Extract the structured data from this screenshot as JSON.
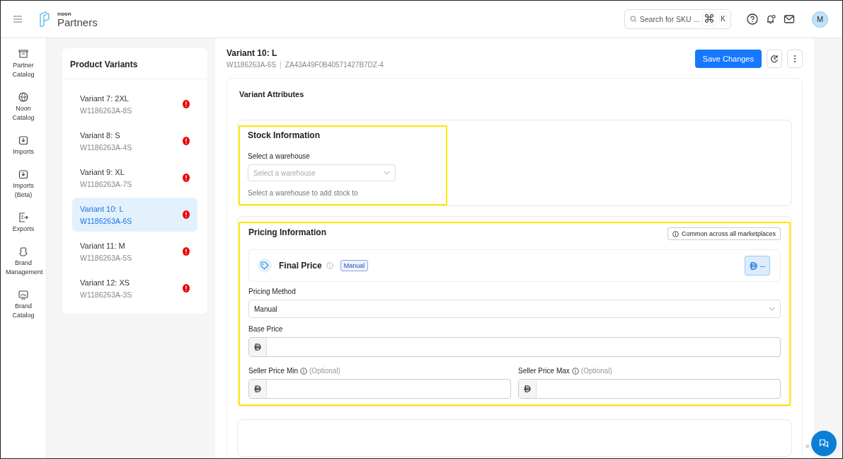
{
  "header": {
    "logo_small": "noon",
    "logo": "Partners",
    "search": {
      "placeholder": "Search for SKU ..."
    },
    "shortcut": [
      "⌘",
      "K"
    ],
    "avatar": "M"
  },
  "nav": [
    {
      "label": "Partner Catalog"
    },
    {
      "label": "Noon Catalog"
    },
    {
      "label": "Imports"
    },
    {
      "label": "Imports (Beta)"
    },
    {
      "label": "Exports"
    },
    {
      "label": "Brand Management"
    },
    {
      "label": "Brand Catalog"
    }
  ],
  "variants": {
    "title": "Product Variants",
    "items": [
      {
        "name": "Variant 7: 2XL",
        "sku": "W1186263A-8S",
        "selected": false,
        "warning": true
      },
      {
        "name": "Variant 8: S",
        "sku": "W1186263A-4S",
        "selected": false,
        "warning": true
      },
      {
        "name": "Variant 9: XL",
        "sku": "W1186263A-7S",
        "selected": false,
        "warning": true
      },
      {
        "name": "Variant 10: L",
        "sku": "W1186263A-6S",
        "selected": true,
        "warning": true
      },
      {
        "name": "Variant 11: M",
        "sku": "W1186263A-5S",
        "selected": false,
        "warning": true
      },
      {
        "name": "Variant 12: XS",
        "sku": "W1186263A-3S",
        "selected": false,
        "warning": true
      }
    ]
  },
  "main": {
    "title": "Variant 10: L",
    "skus": [
      "W1186263A-6S",
      "ZA43A49F0B40571427B7DZ-4"
    ],
    "save_button": "Save Changes",
    "section_title": "Variant Attributes",
    "stock": {
      "highlighted": true,
      "title": "Stock Information",
      "field_label": "Select a warehouse",
      "placeholder": "Select a warehouse",
      "help": "Select a warehouse to add stock to"
    },
    "pricing": {
      "highlighted": true,
      "title": "Pricing Information",
      "note": "Common across all marketplaces",
      "final_price": {
        "label": "Final Price",
        "badge": "Manual",
        "value": "--"
      },
      "method": {
        "label": "Pricing Method",
        "value": "Manual"
      },
      "base_price": {
        "label": "Base Price"
      },
      "min": {
        "label": "Seller Price Min",
        "optional": "(Optional)"
      },
      "max": {
        "label": "Seller Price Max",
        "optional": "(Optional)"
      }
    }
  },
  "collapse_glyph": "»"
}
